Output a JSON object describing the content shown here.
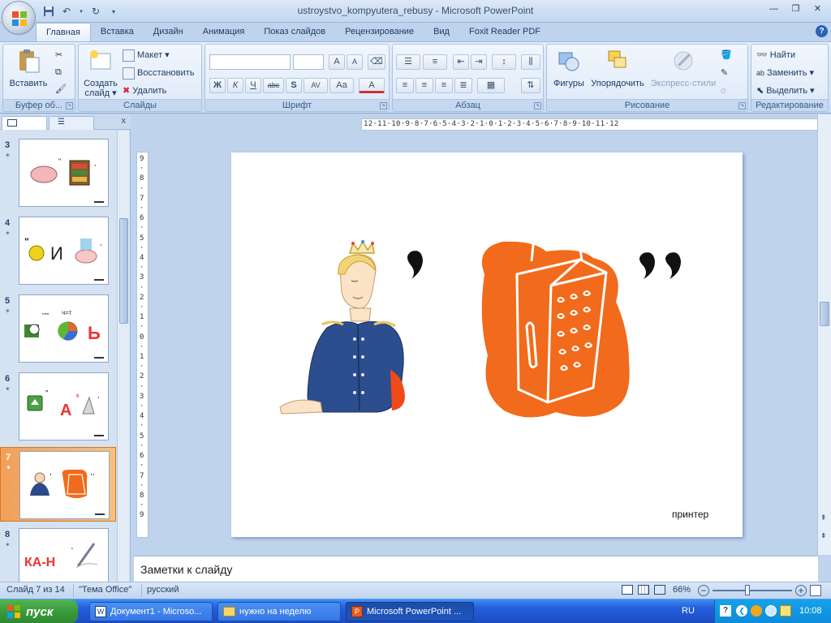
{
  "window": {
    "title": "ustroystvo_kompyutera_rebusy - Microsoft PowerPoint"
  },
  "quick_access": {
    "save_icon": "save-icon",
    "undo_icon": "undo-icon",
    "redo_icon": "redo-icon"
  },
  "tabs": [
    {
      "label": "Главная",
      "active": true
    },
    {
      "label": "Вставка"
    },
    {
      "label": "Дизайн"
    },
    {
      "label": "Анимация"
    },
    {
      "label": "Показ слайдов"
    },
    {
      "label": "Рецензирование"
    },
    {
      "label": "Вид"
    },
    {
      "label": "Foxit Reader PDF"
    }
  ],
  "ribbon": {
    "clipboard": {
      "group_label": "Буфер об...",
      "paste_label": "Вставить"
    },
    "slides": {
      "group_label": "Слайды",
      "create_label_1": "Создать",
      "create_label_2": "слайд",
      "layout_label": "Макет",
      "restore_label": "Восстановить",
      "delete_label": "Удалить"
    },
    "font": {
      "group_label": "Шрифт",
      "bold": "Ж",
      "italic": "К",
      "underline": "Ч",
      "strike": "abc",
      "shadow": "S",
      "spacing": "AV",
      "case": "Aa",
      "color": "A",
      "grow": "A",
      "shrink": "A"
    },
    "paragraph": {
      "group_label": "Абзац"
    },
    "drawing": {
      "group_label": "Рисование",
      "shapes_label": "Фигуры",
      "arrange_label": "Упорядочить",
      "styles_label": "Экспресс-стили"
    },
    "editing": {
      "group_label": "Редактирование",
      "find_label": "Найти",
      "replace_label": "Заменить",
      "select_label": "Выделить"
    }
  },
  "thumbnails": [
    {
      "number": "3",
      "selected": false
    },
    {
      "number": "4",
      "selected": false,
      "text": "И"
    },
    {
      "number": "5",
      "selected": false,
      "text": "Ь",
      "small": "ч=т"
    },
    {
      "number": "6",
      "selected": false,
      "text": "А",
      "small": "к"
    },
    {
      "number": "7",
      "selected": true
    },
    {
      "number": "8",
      "selected": false,
      "text": "КА-Н"
    }
  ],
  "slide": {
    "caption": "принтер"
  },
  "ruler": {
    "h_ticks": "12·11·10·9·8·7·6·5·4·3·2·1·0·1·2·3·4·5·6·7·8·9·10·11·12",
    "v_ticks": "9·8·7·6·5·4·3·2·1·0·1·2·3·4·5·6·7·8·9"
  },
  "notes": {
    "placeholder": "Заметки к слайду"
  },
  "status": {
    "slide_info": "Слайд 7 из 14",
    "theme": "\"Тема Office\"",
    "language": "русский",
    "zoom": "66%"
  },
  "taskbar": {
    "start_label": "пуск",
    "tasks": [
      {
        "label": "Документ1 - Microso..."
      },
      {
        "label": "нужно на неделю"
      },
      {
        "label": "Microsoft PowerPoint ...",
        "active": true
      }
    ],
    "lang": "RU",
    "clock": "10:08"
  },
  "colors": {
    "accent_orange": "#f26a1b",
    "ribbon_blue": "#d5e3f4",
    "taskbar_blue": "#245edb"
  }
}
